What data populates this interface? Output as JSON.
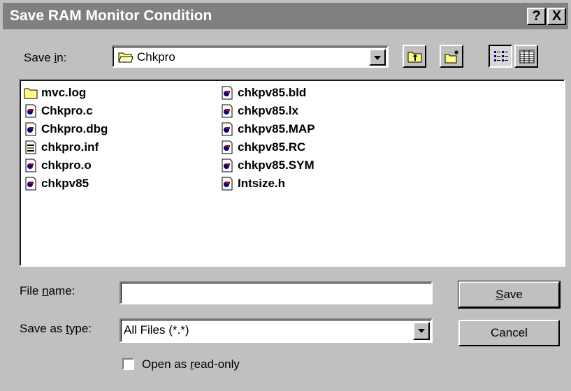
{
  "dialog": {
    "title": "Save RAM Monitor Condition",
    "help_btn": "?",
    "close_btn": "X"
  },
  "save_in": {
    "label_pre": "Save ",
    "label_key": "i",
    "label_post": "n:",
    "value": "Chkpro"
  },
  "files": [
    {
      "name": "mvc.log",
      "icon": "folder-icon"
    },
    {
      "name": "Chkpro.c",
      "icon": "file-icon"
    },
    {
      "name": "Chkpro.dbg",
      "icon": "file-icon"
    },
    {
      "name": "chkpro.inf",
      "icon": "config-file-icon"
    },
    {
      "name": "chkpro.o",
      "icon": "file-icon"
    },
    {
      "name": "chkpv85",
      "icon": "file-icon"
    },
    {
      "name": "chkpv85.bld",
      "icon": "file-icon"
    },
    {
      "name": "chkpv85.lx",
      "icon": "file-icon"
    },
    {
      "name": "chkpv85.MAP",
      "icon": "file-icon"
    },
    {
      "name": "chkpv85.RC",
      "icon": "file-icon"
    },
    {
      "name": "chkpv85.SYM",
      "icon": "file-icon"
    },
    {
      "name": "Intsize.h",
      "icon": "file-icon"
    }
  ],
  "file_name": {
    "label_pre": "File ",
    "label_key": "n",
    "label_post": "ame:",
    "value": ""
  },
  "save_type": {
    "label_pre": "Save as ",
    "label_key": "t",
    "label_post": "ype:",
    "value": "All Files (*.*)"
  },
  "buttons": {
    "save_key": "S",
    "save_rest": "ave",
    "cancel": "Cancel"
  },
  "read_only": {
    "label_pre": "Open as ",
    "label_key": "r",
    "label_post": "ead-only",
    "checked": false
  },
  "colors": {
    "title_bar": "#808080",
    "face": "#c0c0c0",
    "folder": "#ffff80"
  }
}
